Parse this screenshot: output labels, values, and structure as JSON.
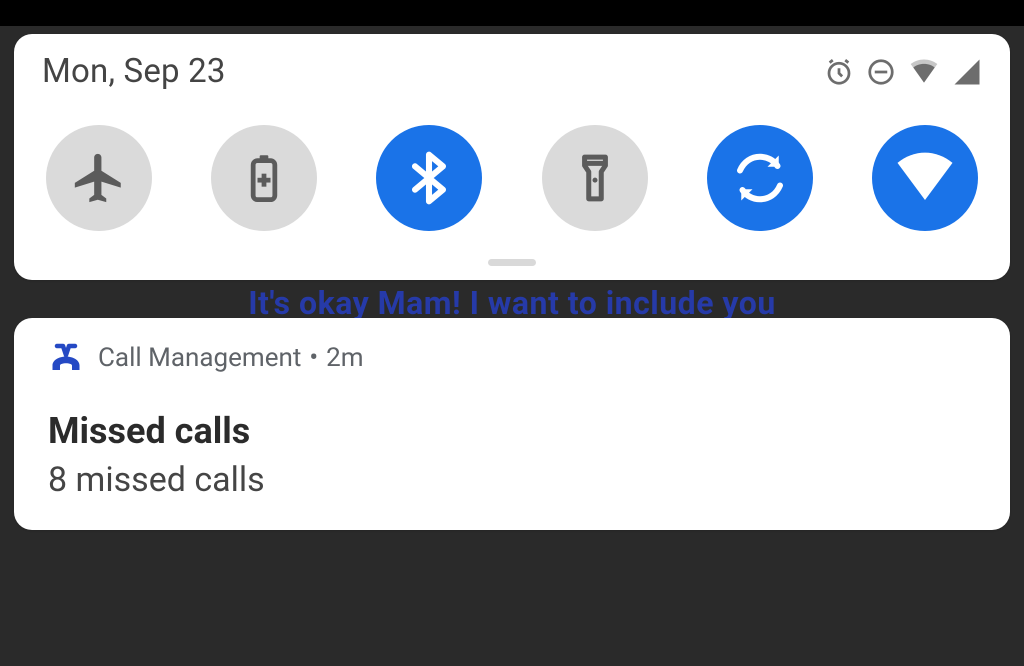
{
  "status_bar": {
    "date": "Mon, Sep 23"
  },
  "quick_settings": {
    "tiles": [
      {
        "name": "airplane-mode",
        "active": false
      },
      {
        "name": "battery-saver",
        "active": false
      },
      {
        "name": "bluetooth",
        "active": true
      },
      {
        "name": "flashlight",
        "active": false
      },
      {
        "name": "auto-rotate",
        "active": true
      },
      {
        "name": "wifi",
        "active": true
      }
    ]
  },
  "background_text": "It's okay Mam! I want to include you",
  "notification": {
    "app_name": "Call Management",
    "separator": " • ",
    "age": "2m",
    "title": "Missed calls",
    "body": "8 missed calls"
  },
  "colors": {
    "tile_on": "#1a73e8",
    "tile_off": "#dadada",
    "icon_on": "#ffffff",
    "icon_off": "#5b5b5b",
    "app_icon": "#2549c4"
  }
}
